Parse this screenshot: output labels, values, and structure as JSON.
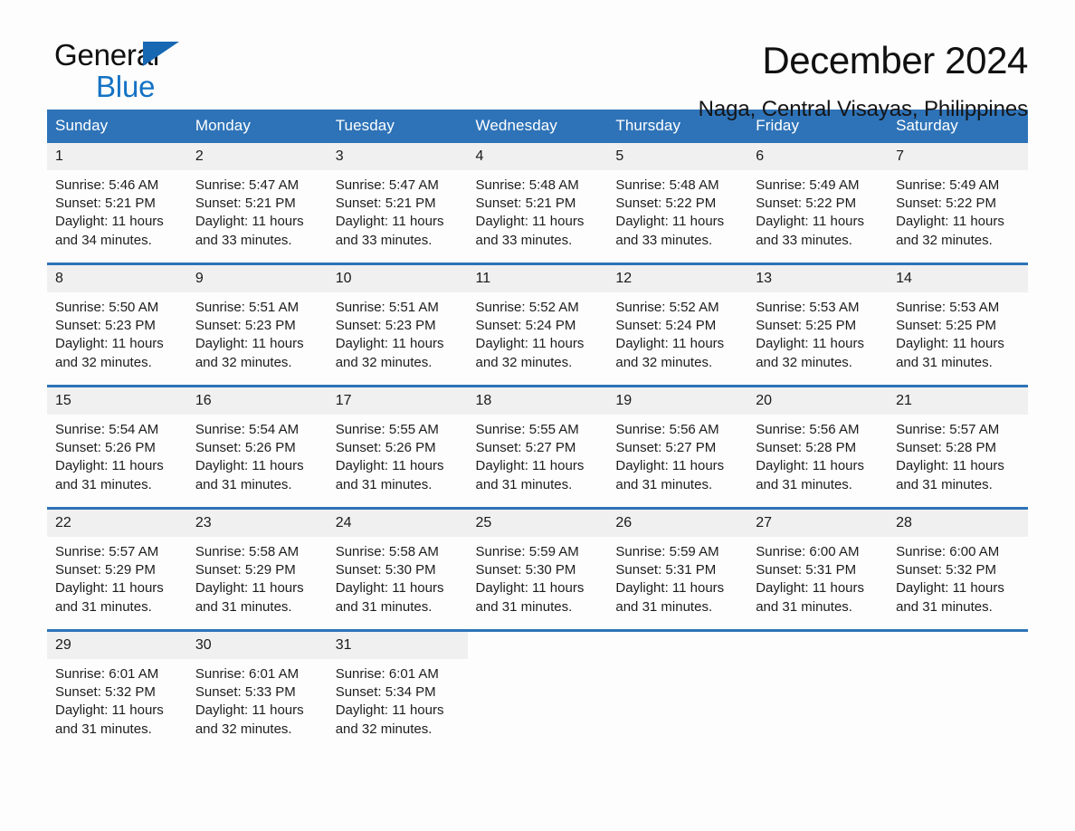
{
  "brand": {
    "name_part1": "General",
    "name_part2": "Blue",
    "triangle_color": "#1668b3",
    "blue_color": "#1472c4"
  },
  "header": {
    "title": "December 2024",
    "subtitle": "Naga, Central Visayas, Philippines"
  },
  "theme": {
    "header_blue": "#2e73b8",
    "daynum_gray": "#f0f0f0",
    "page_background": "#fdfdfd"
  },
  "weekdays": [
    "Sunday",
    "Monday",
    "Tuesday",
    "Wednesday",
    "Thursday",
    "Friday",
    "Saturday"
  ],
  "weeks": [
    {
      "days": [
        {
          "num": "1",
          "sunrise": "Sunrise: 5:46 AM",
          "sunset": "Sunset: 5:21 PM",
          "daylight": "Daylight: 11 hours and 34 minutes."
        },
        {
          "num": "2",
          "sunrise": "Sunrise: 5:47 AM",
          "sunset": "Sunset: 5:21 PM",
          "daylight": "Daylight: 11 hours and 33 minutes."
        },
        {
          "num": "3",
          "sunrise": "Sunrise: 5:47 AM",
          "sunset": "Sunset: 5:21 PM",
          "daylight": "Daylight: 11 hours and 33 minutes."
        },
        {
          "num": "4",
          "sunrise": "Sunrise: 5:48 AM",
          "sunset": "Sunset: 5:21 PM",
          "daylight": "Daylight: 11 hours and 33 minutes."
        },
        {
          "num": "5",
          "sunrise": "Sunrise: 5:48 AM",
          "sunset": "Sunset: 5:22 PM",
          "daylight": "Daylight: 11 hours and 33 minutes."
        },
        {
          "num": "6",
          "sunrise": "Sunrise: 5:49 AM",
          "sunset": "Sunset: 5:22 PM",
          "daylight": "Daylight: 11 hours and 33 minutes."
        },
        {
          "num": "7",
          "sunrise": "Sunrise: 5:49 AM",
          "sunset": "Sunset: 5:22 PM",
          "daylight": "Daylight: 11 hours and 32 minutes."
        }
      ]
    },
    {
      "days": [
        {
          "num": "8",
          "sunrise": "Sunrise: 5:50 AM",
          "sunset": "Sunset: 5:23 PM",
          "daylight": "Daylight: 11 hours and 32 minutes."
        },
        {
          "num": "9",
          "sunrise": "Sunrise: 5:51 AM",
          "sunset": "Sunset: 5:23 PM",
          "daylight": "Daylight: 11 hours and 32 minutes."
        },
        {
          "num": "10",
          "sunrise": "Sunrise: 5:51 AM",
          "sunset": "Sunset: 5:23 PM",
          "daylight": "Daylight: 11 hours and 32 minutes."
        },
        {
          "num": "11",
          "sunrise": "Sunrise: 5:52 AM",
          "sunset": "Sunset: 5:24 PM",
          "daylight": "Daylight: 11 hours and 32 minutes."
        },
        {
          "num": "12",
          "sunrise": "Sunrise: 5:52 AM",
          "sunset": "Sunset: 5:24 PM",
          "daylight": "Daylight: 11 hours and 32 minutes."
        },
        {
          "num": "13",
          "sunrise": "Sunrise: 5:53 AM",
          "sunset": "Sunset: 5:25 PM",
          "daylight": "Daylight: 11 hours and 32 minutes."
        },
        {
          "num": "14",
          "sunrise": "Sunrise: 5:53 AM",
          "sunset": "Sunset: 5:25 PM",
          "daylight": "Daylight: 11 hours and 31 minutes."
        }
      ]
    },
    {
      "days": [
        {
          "num": "15",
          "sunrise": "Sunrise: 5:54 AM",
          "sunset": "Sunset: 5:26 PM",
          "daylight": "Daylight: 11 hours and 31 minutes."
        },
        {
          "num": "16",
          "sunrise": "Sunrise: 5:54 AM",
          "sunset": "Sunset: 5:26 PM",
          "daylight": "Daylight: 11 hours and 31 minutes."
        },
        {
          "num": "17",
          "sunrise": "Sunrise: 5:55 AM",
          "sunset": "Sunset: 5:26 PM",
          "daylight": "Daylight: 11 hours and 31 minutes."
        },
        {
          "num": "18",
          "sunrise": "Sunrise: 5:55 AM",
          "sunset": "Sunset: 5:27 PM",
          "daylight": "Daylight: 11 hours and 31 minutes."
        },
        {
          "num": "19",
          "sunrise": "Sunrise: 5:56 AM",
          "sunset": "Sunset: 5:27 PM",
          "daylight": "Daylight: 11 hours and 31 minutes."
        },
        {
          "num": "20",
          "sunrise": "Sunrise: 5:56 AM",
          "sunset": "Sunset: 5:28 PM",
          "daylight": "Daylight: 11 hours and 31 minutes."
        },
        {
          "num": "21",
          "sunrise": "Sunrise: 5:57 AM",
          "sunset": "Sunset: 5:28 PM",
          "daylight": "Daylight: 11 hours and 31 minutes."
        }
      ]
    },
    {
      "days": [
        {
          "num": "22",
          "sunrise": "Sunrise: 5:57 AM",
          "sunset": "Sunset: 5:29 PM",
          "daylight": "Daylight: 11 hours and 31 minutes."
        },
        {
          "num": "23",
          "sunrise": "Sunrise: 5:58 AM",
          "sunset": "Sunset: 5:29 PM",
          "daylight": "Daylight: 11 hours and 31 minutes."
        },
        {
          "num": "24",
          "sunrise": "Sunrise: 5:58 AM",
          "sunset": "Sunset: 5:30 PM",
          "daylight": "Daylight: 11 hours and 31 minutes."
        },
        {
          "num": "25",
          "sunrise": "Sunrise: 5:59 AM",
          "sunset": "Sunset: 5:30 PM",
          "daylight": "Daylight: 11 hours and 31 minutes."
        },
        {
          "num": "26",
          "sunrise": "Sunrise: 5:59 AM",
          "sunset": "Sunset: 5:31 PM",
          "daylight": "Daylight: 11 hours and 31 minutes."
        },
        {
          "num": "27",
          "sunrise": "Sunrise: 6:00 AM",
          "sunset": "Sunset: 5:31 PM",
          "daylight": "Daylight: 11 hours and 31 minutes."
        },
        {
          "num": "28",
          "sunrise": "Sunrise: 6:00 AM",
          "sunset": "Sunset: 5:32 PM",
          "daylight": "Daylight: 11 hours and 31 minutes."
        }
      ]
    },
    {
      "days": [
        {
          "num": "29",
          "sunrise": "Sunrise: 6:01 AM",
          "sunset": "Sunset: 5:32 PM",
          "daylight": "Daylight: 11 hours and 31 minutes."
        },
        {
          "num": "30",
          "sunrise": "Sunrise: 6:01 AM",
          "sunset": "Sunset: 5:33 PM",
          "daylight": "Daylight: 11 hours and 32 minutes."
        },
        {
          "num": "31",
          "sunrise": "Sunrise: 6:01 AM",
          "sunset": "Sunset: 5:34 PM",
          "daylight": "Daylight: 11 hours and 32 minutes."
        },
        {
          "num": "",
          "sunrise": "",
          "sunset": "",
          "daylight": ""
        },
        {
          "num": "",
          "sunrise": "",
          "sunset": "",
          "daylight": ""
        },
        {
          "num": "",
          "sunrise": "",
          "sunset": "",
          "daylight": ""
        },
        {
          "num": "",
          "sunrise": "",
          "sunset": "",
          "daylight": ""
        }
      ]
    }
  ]
}
